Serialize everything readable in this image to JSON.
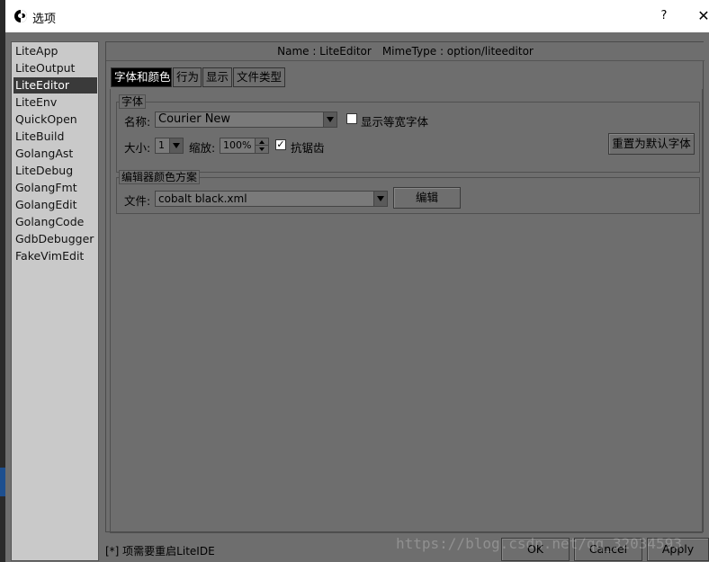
{
  "window": {
    "title": "选项",
    "help_label": "?",
    "close_label": "✕"
  },
  "sidebar": {
    "items": [
      {
        "label": "LiteApp",
        "selected": false
      },
      {
        "label": "LiteOutput",
        "selected": false
      },
      {
        "label": "LiteEditor",
        "selected": true
      },
      {
        "label": "LiteEnv",
        "selected": false
      },
      {
        "label": "QuickOpen",
        "selected": false
      },
      {
        "label": "LiteBuild",
        "selected": false
      },
      {
        "label": "GolangAst",
        "selected": false
      },
      {
        "label": "LiteDebug",
        "selected": false
      },
      {
        "label": "GolangFmt",
        "selected": false
      },
      {
        "label": "GolangEdit",
        "selected": false
      },
      {
        "label": "GolangCode",
        "selected": false
      },
      {
        "label": "GdbDebugger",
        "selected": false
      },
      {
        "label": "FakeVimEdit",
        "selected": false
      }
    ]
  },
  "header": {
    "name": "Name : LiteEditor",
    "mimetype": "MimeType : option/liteeditor"
  },
  "tabs": [
    {
      "label": "字体和颜色",
      "active": true
    },
    {
      "label": "行为",
      "active": false
    },
    {
      "label": "显示",
      "active": false
    },
    {
      "label": "文件类型",
      "active": false
    }
  ],
  "font_group": {
    "title": "字体",
    "name_label": "名称:",
    "font_value": "Courier New",
    "monospace_checkbox_label": "显示等宽字体",
    "monospace_checked": false,
    "size_label": "大小:",
    "size_value": "1",
    "zoom_label": "缩放:",
    "zoom_value": "100%",
    "antialias_label": "抗锯齿",
    "antialias_checked": true,
    "reset_button": "重置为默认字体"
  },
  "color_group": {
    "title": "编辑器颜色方案",
    "file_label": "文件:",
    "file_value": "cobalt black.xml",
    "edit_button": "编辑"
  },
  "footer": {
    "note": "[*] 项需要重启LiteIDE",
    "ok": "OK",
    "cancel": "Cancel",
    "apply": "Apply",
    "watermark": "https://blog.csdn.net/qq_32034593"
  }
}
